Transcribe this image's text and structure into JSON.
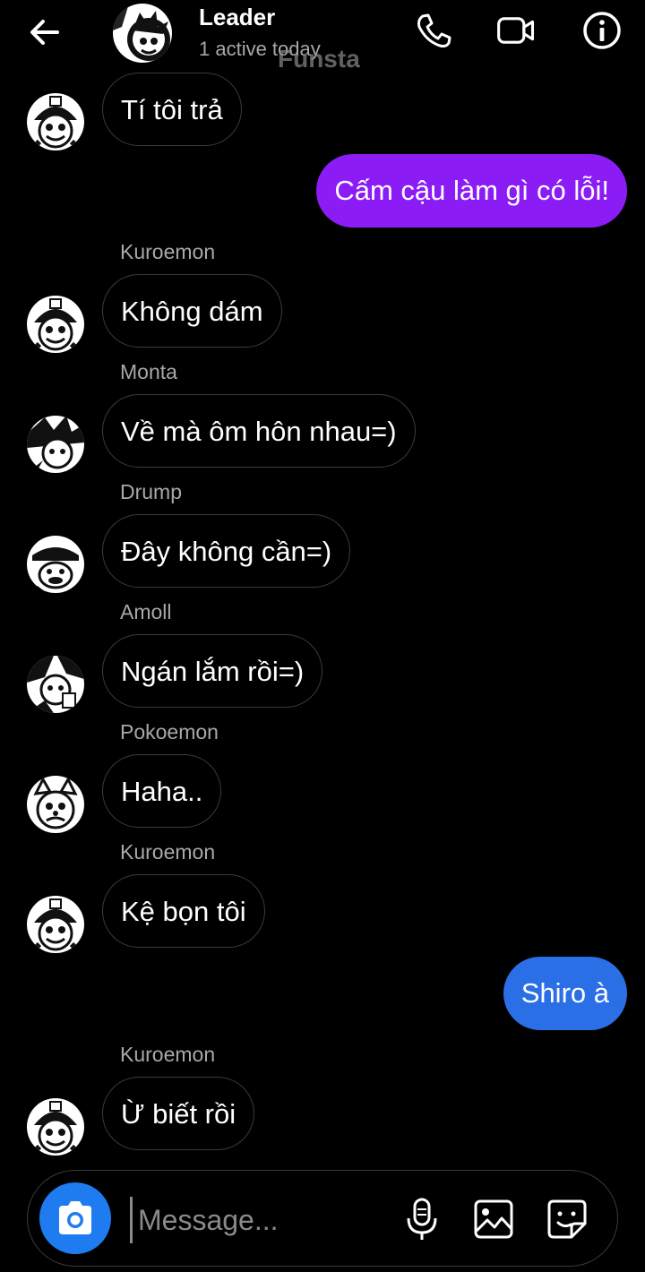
{
  "header": {
    "title": "Leader",
    "subtitle": "1 active today",
    "watermark": "Funsta"
  },
  "messages": [
    {
      "sender": "",
      "text": "Tí tôi trả",
      "direction": "in"
    },
    {
      "sender": "",
      "text": "Cấm cậu làm gì có lỗi!",
      "direction": "out",
      "color": "#8b1cf5"
    },
    {
      "sender": "Kuroemon",
      "text": "Không dám",
      "direction": "in"
    },
    {
      "sender": "Monta",
      "text": "Về mà ôm hôn nhau=)",
      "direction": "in"
    },
    {
      "sender": "Drump",
      "text": "Đây không cần=)",
      "direction": "in"
    },
    {
      "sender": "Amoll",
      "text": "Ngán lắm rồi=)",
      "direction": "in"
    },
    {
      "sender": "Pokoemon",
      "text": "Haha..",
      "direction": "in"
    },
    {
      "sender": "Kuroemon",
      "text": "Kệ bọn tôi",
      "direction": "in"
    },
    {
      "sender": "",
      "text": "Shiro à",
      "direction": "out",
      "color": "#2a6fe6"
    },
    {
      "sender": "Kuroemon",
      "text": "Ừ biết rồi",
      "direction": "in"
    }
  ],
  "composer": {
    "placeholder": "Message..."
  },
  "icons": {
    "back": "arrow-left-icon",
    "call": "phone-icon",
    "video": "video-camera-icon",
    "info": "info-icon",
    "camera": "camera-icon",
    "mic": "microphone-icon",
    "gallery": "image-icon",
    "sticker": "sticker-icon"
  },
  "colors": {
    "accent_purple": "#8b1cf5",
    "accent_blue": "#2a6fe6",
    "camera_button": "#1f7cf0"
  }
}
